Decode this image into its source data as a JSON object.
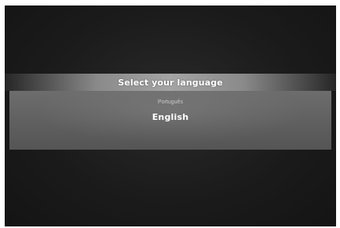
{
  "status": {
    "line1": "",
    "line2": ""
  },
  "header": {
    "title": "Select your language"
  },
  "languages": {
    "options": [
      {
        "label": "Português",
        "selected": false
      },
      {
        "label": "English",
        "selected": true
      }
    ]
  },
  "colors": {
    "background": "#1b1b1b",
    "header_bar": "#a4a4a4",
    "panel": "#636363",
    "selected_text": "#ffffff",
    "unselected_text": "#c8c8c8"
  }
}
